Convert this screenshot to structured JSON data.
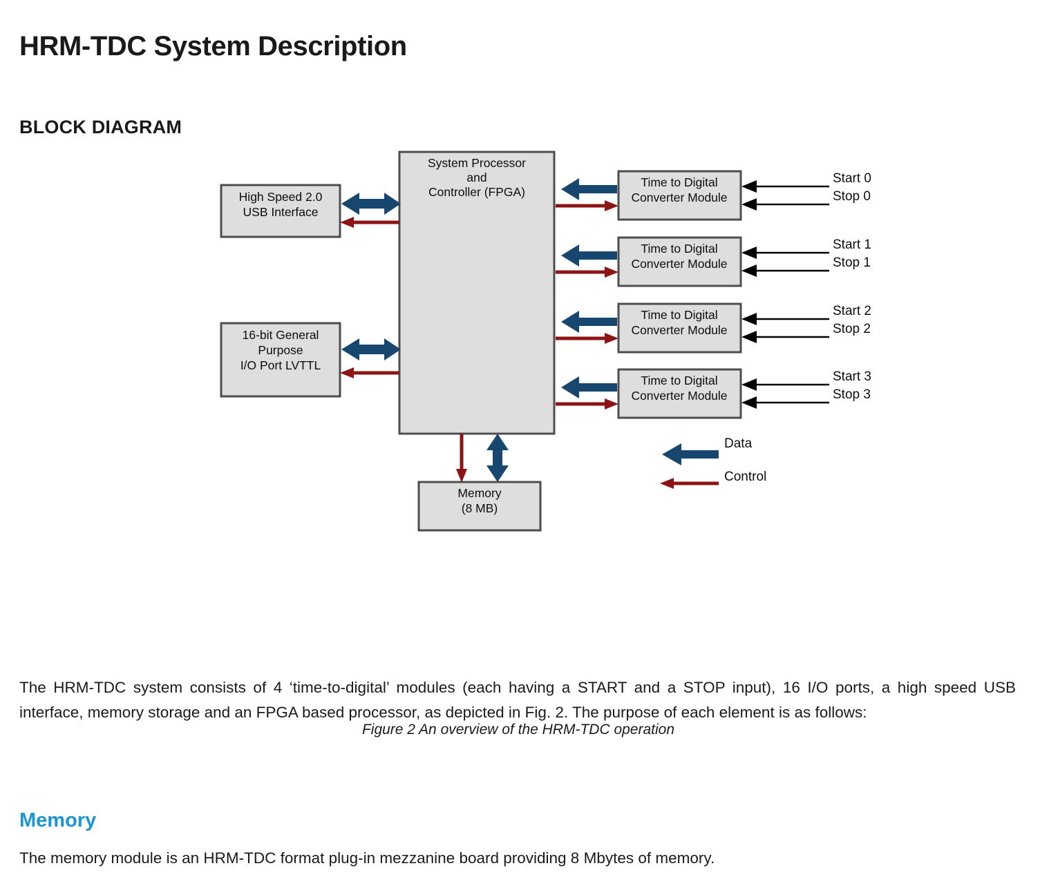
{
  "document": {
    "title": "HRM-TDC System Description",
    "section_heading": "BLOCK DIAGRAM",
    "figure_caption": "Figure 2  An overview of the HRM-TDC operation",
    "intro_paragraph": "The HRM-TDC system consists of 4 ‘time-to-digital’ modules (each having a START and a STOP input), 16 I/O ports, a high speed USB interface, memory storage and an FPGA based processor, as depicted in Fig. 2. The purpose of each element is as follows:",
    "memory_subheading": "Memory",
    "memory_paragraph": "The memory module is an HRM-TDC format plug-in mezzanine board providing 8 Mbytes of memory."
  },
  "diagram": {
    "blocks": {
      "usb": {
        "line1": "High Speed 2.0",
        "line2": "USB Interface"
      },
      "io_port": {
        "line1": "16-bit General",
        "line2": "Purpose",
        "line3": "I/O Port LVTTL"
      },
      "fpga": {
        "line1": "System Processor",
        "line2": "and",
        "line3": "Controller (FPGA)"
      },
      "memory": {
        "line1": "Memory",
        "line2": "(8 MB)"
      },
      "tdc": [
        {
          "line1": "Time to Digital",
          "line2": "Converter Module",
          "start": "Start 0",
          "stop": "Stop 0"
        },
        {
          "line1": "Time to Digital",
          "line2": "Converter Module",
          "start": "Start 1",
          "stop": "Stop 1"
        },
        {
          "line1": "Time to Digital",
          "line2": "Converter Module",
          "start": "Start 2",
          "stop": "Stop 2"
        },
        {
          "line1": "Time to Digital",
          "line2": "Converter Module",
          "start": "Start 3",
          "stop": "Stop 3"
        }
      ]
    },
    "legend": {
      "data_label": "Data",
      "control_label": "Control"
    },
    "colors": {
      "data_arrow": "#17476f",
      "control_arrow": "#8c1414",
      "block_fill": "#dedede",
      "block_stroke": "#4d4d4d",
      "signal_arrow": "#000000",
      "accent_heading": "#1b96d2"
    }
  }
}
